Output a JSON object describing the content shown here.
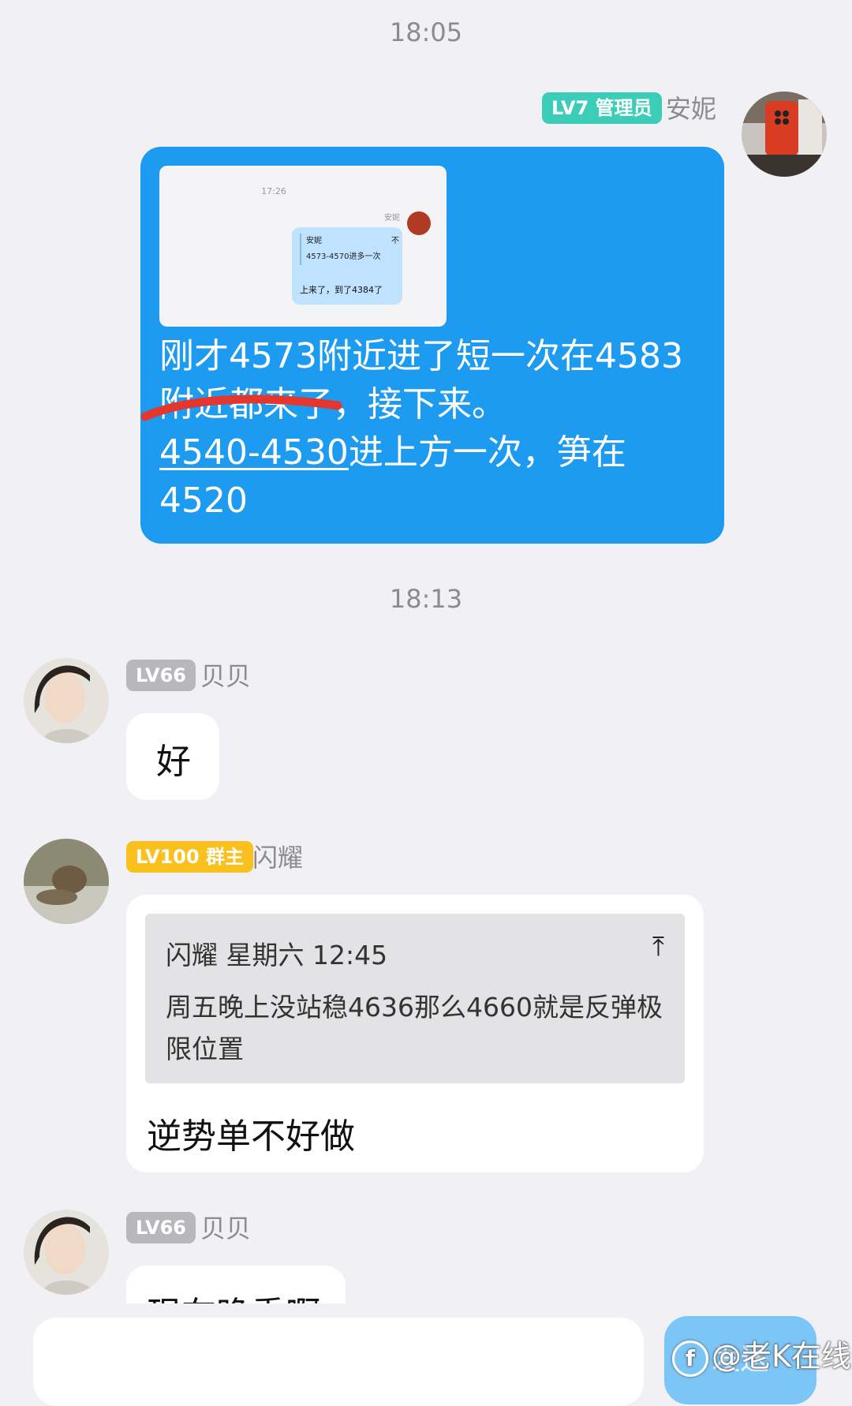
{
  "timestamps": [
    "18:05",
    "18:13"
  ],
  "colors": {
    "background": "#f1f1f5",
    "outgoing_bubble": "#1d9bf0",
    "admin_badge": "#3ccdb8",
    "level_badge": "#b7b7bc",
    "owner_badge": "#f9c01e",
    "send_button": "#7cc5f7",
    "strike_mark": "#e3362f"
  },
  "msg1": {
    "badge": "LV7 管理员",
    "sender": "安妮",
    "avatar_icon": "person-holding-red-phone",
    "screenshot": {
      "time": "17:26",
      "name": "安妮",
      "quote_name": "安妮",
      "quote_arrow": "不",
      "quote_text": "4573-4570进多一次",
      "message": "上来了，到了4384了"
    },
    "text_line1": "刚才4573附近进了短一次在4583",
    "text_line2a": "附近都来了",
    "text_line2b": "，接下来。",
    "text_line3a": "4540-4530",
    "text_line3b": "进上方一次，笋在",
    "text_line4": "4520"
  },
  "msg2": {
    "badge": "LV66",
    "sender": "贝贝",
    "text": "好"
  },
  "msg3": {
    "badge": "LV100 群主",
    "sender": "闪耀",
    "reply_header": "闪耀  星期六 12:45",
    "reply_icon": "pin-top-icon",
    "reply_body": "周五晚上没站稳4636那么4660就是反弹极限位置",
    "text": "逆势单不好做"
  },
  "msg4": {
    "badge": "LV66",
    "sender": "贝贝",
    "text": "现在晚重啊"
  },
  "input": {
    "placeholder": "",
    "send_label": "发送"
  },
  "watermark": {
    "icon_glyph": "f",
    "text": "@老K在线"
  }
}
